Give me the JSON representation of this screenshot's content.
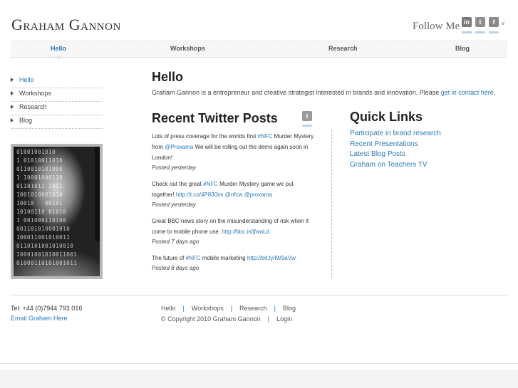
{
  "header": {
    "logo": "Graham Gannon",
    "follow_label": "Follow Me",
    "social": [
      {
        "name": "linkedin",
        "glyph": "in",
        "color": "#7a7a7a"
      },
      {
        "name": "twitter",
        "glyph": "t",
        "color": "#8e8e8e"
      },
      {
        "name": "facebook",
        "glyph": "f",
        "color": "#8a8a8a"
      }
    ],
    "more_glyph": "v"
  },
  "nav": {
    "items": [
      "Hello",
      "Workshops",
      "Research",
      "Blog"
    ],
    "active": "Hello"
  },
  "sidebar": {
    "items": [
      "Hello",
      "Workshops",
      "Research",
      "Blog"
    ]
  },
  "portrait": {
    "binary_rows": [
      "01001001010",
      "1 01010011010",
      "0110010101000",
      "1 10001000110",
      "01101011 1011",
      "1001010001010",
      "10010   00101",
      "10100110 01010",
      "1 001000110100",
      "001101010001010",
      "100011001010011",
      "0110101001010010",
      "10001001010011001",
      "01000110101001011"
    ]
  },
  "main": {
    "title": "Hello",
    "intro_text": "Graham Gannon is a entrepreneur and creative strategist interested in brands and innovation. Please ",
    "intro_link": "get in contact here",
    "intro_end": "."
  },
  "twitter": {
    "title": "Recent Twitter Posts",
    "icon_glyph": "t",
    "tweets": [
      {
        "parts": [
          {
            "t": "Lots of press coverage for the worlds first "
          },
          {
            "t": "#NFC",
            "link": true
          },
          {
            "t": " Murder Mystery from "
          },
          {
            "t": "@Proxama",
            "link": true
          },
          {
            "t": " We will be rolling out the demo again soon in London!"
          }
        ],
        "meta": "Posted yesterday"
      },
      {
        "parts": [
          {
            "t": "Check out the great "
          },
          {
            "t": "#NFC",
            "link": true
          },
          {
            "t": " Murder Mystery game we put together! "
          },
          {
            "t": "http://t.co/4P830im",
            "link": true
          },
          {
            "t": " "
          },
          {
            "t": "@nfcw",
            "link": true
          },
          {
            "t": " "
          },
          {
            "t": "@proxama",
            "link": true
          }
        ],
        "meta": "Posted yesterday"
      },
      {
        "parts": [
          {
            "t": "Great BBC news story on the misunderstanding of risk when it come to mobile phone use. "
          },
          {
            "t": "http://bbc.in/jfwaLd",
            "link": true
          }
        ],
        "meta": "Posted 7 days ago"
      },
      {
        "parts": [
          {
            "t": "The future of "
          },
          {
            "t": "#NFC",
            "link": true
          },
          {
            "t": " mobile marketing "
          },
          {
            "t": "http://bit.ly/lW9aVw",
            "link": true
          }
        ],
        "meta": "Posted 8 days ago"
      }
    ]
  },
  "quick_links": {
    "title": "Quick Links",
    "items": [
      "Participate in brand research",
      "Recent Presentations",
      "Latest Blog Posts",
      "Graham on Teachers TV"
    ]
  },
  "footer": {
    "phone": "Tel: +44 (0)7944 793 016",
    "email_label": "Email Graham Here",
    "nav": [
      "Hello",
      "Workshops",
      "Research",
      "Blog"
    ],
    "separator": "|",
    "copyright": "© Copyright 2010 Graham Gannon",
    "login": "Login"
  }
}
